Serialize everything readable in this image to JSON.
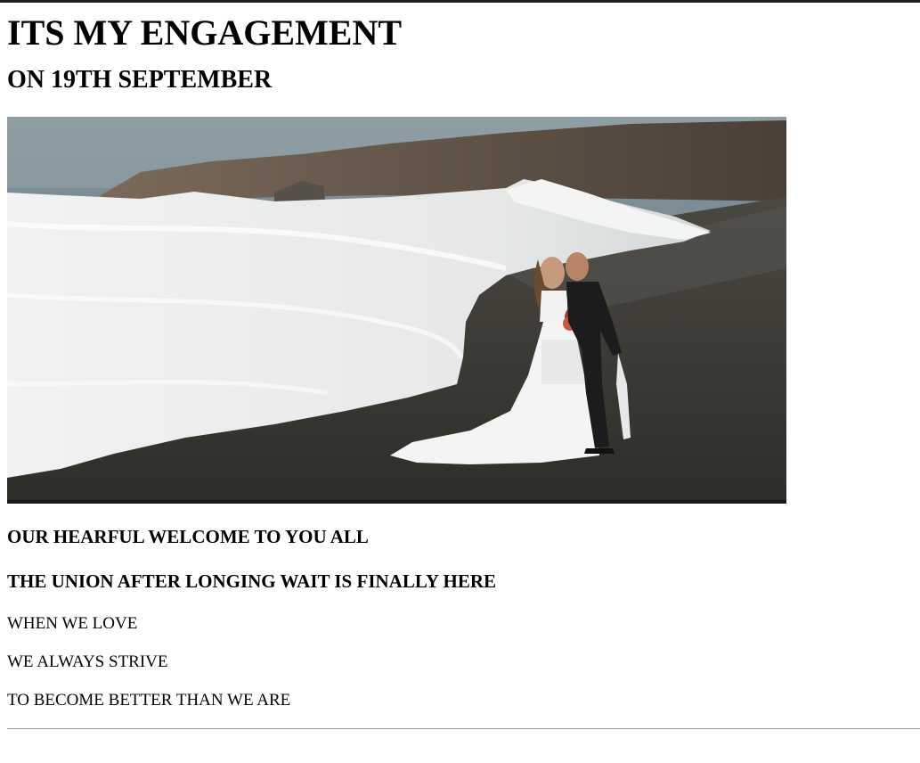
{
  "heading": {
    "title": "ITS MY ENGAGEMENT",
    "subtitle": "ON 19TH SEPTEMBER"
  },
  "photo": {
    "icon": "wedding-couple-beach-image"
  },
  "welcome": {
    "line1": "OUR HEARFUL WELCOME TO YOU ALL",
    "line2": "THE UNION AFTER LONGING WAIT IS FINALLY HERE"
  },
  "poem": {
    "line1": "WHEN WE LOVE",
    "line2": "WE ALWAYS STRIVE",
    "line3": "TO BECOME BETTER THAN WE ARE"
  }
}
